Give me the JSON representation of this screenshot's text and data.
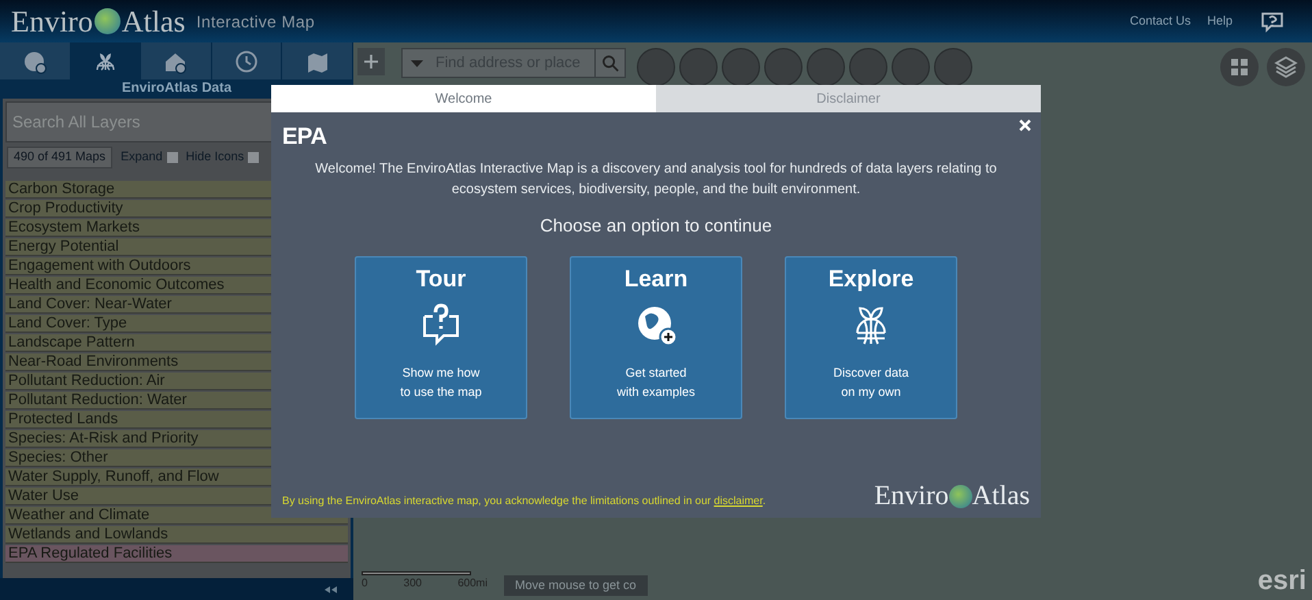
{
  "header": {
    "logo_left": "Enviro",
    "logo_right": "Atlas",
    "subtitle": "Interactive Map",
    "links": [
      "Contact Us",
      "Help"
    ]
  },
  "panel": {
    "tabs": [
      {
        "kind": "globe",
        "selected": false
      },
      {
        "kind": "data",
        "selected": true
      },
      {
        "kind": "house",
        "selected": false
      },
      {
        "kind": "history",
        "selected": false
      },
      {
        "kind": "map",
        "selected": false
      }
    ],
    "title": "EnviroAtlas Data",
    "search": {
      "placeholder": "Search All Layers"
    },
    "count": "490 of 491 Maps",
    "options": [
      {
        "label": "Expand",
        "checked": false
      },
      {
        "label": "Hide Icons",
        "checked": false
      }
    ],
    "categories": [
      {
        "label": "Carbon Storage",
        "color": "#5a5d48"
      },
      {
        "label": "Crop Productivity",
        "color": "#5a5d48"
      },
      {
        "label": "Ecosystem Markets",
        "color": "#5a5d48"
      },
      {
        "label": "Energy Potential",
        "color": "#5a5d48"
      },
      {
        "label": "Engagement with Outdoors",
        "color": "#5a5d48"
      },
      {
        "label": "Health and Economic Outcomes",
        "color": "#5a5d48"
      },
      {
        "label": "Land Cover: Near-Water",
        "color": "#5a5d48"
      },
      {
        "label": "Land Cover: Type",
        "color": "#5a5d48"
      },
      {
        "label": "Landscape Pattern",
        "color": "#5a5d48"
      },
      {
        "label": "Near-Road Environments",
        "color": "#5a5d48"
      },
      {
        "label": "Pollutant Reduction: Air",
        "color": "#5a5d48"
      },
      {
        "label": "Pollutant Reduction: Water",
        "color": "#5a5d48"
      },
      {
        "label": "Protected Lands",
        "color": "#5a5d48"
      },
      {
        "label": "Species: At-Risk and Priority",
        "color": "#5a5d48"
      },
      {
        "label": "Species: Other",
        "color": "#5a5d48"
      },
      {
        "label": "Water Supply, Runoff, and Flow",
        "color": "#5a5d48"
      },
      {
        "label": "Water Use",
        "color": "#5a5d48"
      },
      {
        "label": "Weather and Climate",
        "color": "#5a5d48"
      },
      {
        "label": "Wetlands and Lowlands",
        "color": "#5a5d48"
      },
      {
        "label": "EPA Regulated Facilities",
        "color": "#6a5560"
      }
    ]
  },
  "map": {
    "search": {
      "placeholder": "Find address or place"
    },
    "scale_labels": [
      "0",
      "300",
      "600mi"
    ],
    "coordinates": "Move mouse to get co",
    "attribution": "esri"
  },
  "dialog": {
    "tabs": [
      {
        "label": "Welcome",
        "selected": true
      },
      {
        "label": "Disclaimer",
        "selected": false
      }
    ],
    "agency": "EPA",
    "intro": "Welcome! The EnviroAtlas Interactive Map is a discovery and analysis tool for hundreds of data layers relating to ecosystem services, biodiversity, people, and the built environment.",
    "prompt": "Choose an option to continue",
    "options": [
      {
        "kind": "tour",
        "title": "Tour",
        "text": "Show me how\nto use the map"
      },
      {
        "kind": "learn",
        "title": "Learn",
        "text": "Get started\nwith examples"
      },
      {
        "kind": "explore",
        "title": "Explore",
        "text": "Discover data\non my own"
      }
    ],
    "footer": {
      "text": "By using the EnviroAtlas interactive map, you acknowledge the limitations outlined in our",
      "link": "disclaimer",
      "end": "."
    },
    "brand_left": "Enviro",
    "brand_right": "Atlas"
  }
}
